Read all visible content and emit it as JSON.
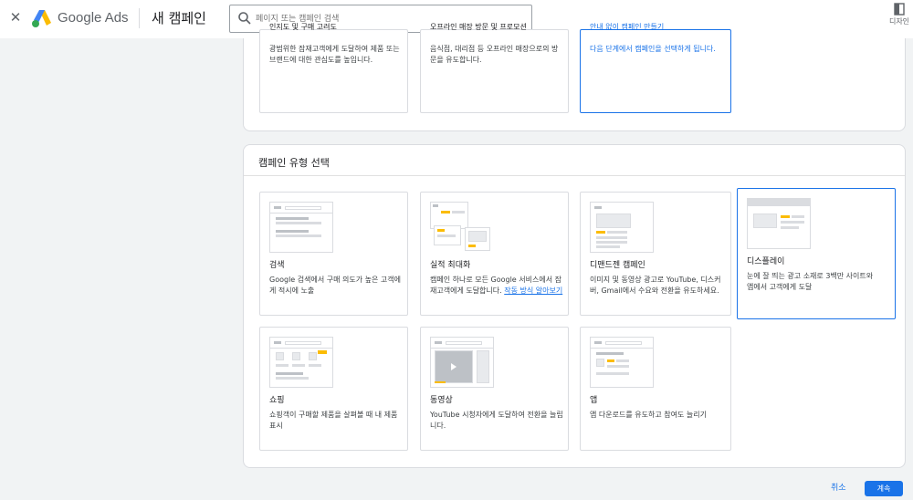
{
  "header": {
    "brand": "Google Ads",
    "page_title": "새 캠페인",
    "search_placeholder": "페이지 또는 캠페인 검색",
    "design_label": "디자인"
  },
  "top_cards": [
    {
      "title": "인지도 및 구매 고려도",
      "desc": "광범위한 잠재고객에게 도달하여 제품 또는 브랜드에 대한 관심도를 높입니다."
    },
    {
      "title": "오프라인 매장 방문 및 프로모션",
      "desc": "음식점, 대리점 등 오프라인 매장으로의 방문을 유도합니다."
    },
    {
      "title": "안내 없이 캠페인 만들기",
      "desc": "다음 단계에서 캠페인을 선택하게 됩니다."
    }
  ],
  "campaign_type": {
    "heading": "캠페인 유형 선택",
    "cards": [
      {
        "title": "검색",
        "desc": "Google 검색에서 구매 의도가 높은 고객에게 적시에 노출"
      },
      {
        "title": "실적 최대화",
        "desc": "캠페인 하나로 모든 Google 서비스에서 잠재고객에게 도달합니다.",
        "link": "작동 방식 알아보기"
      },
      {
        "title": "디맨드젠 캠페인",
        "desc": "이미지 및 동영상 광고로 YouTube, 디스커버, Gmail에서 수요와 전환을 유도하세요."
      },
      {
        "title": "디스플레이",
        "desc": "눈에 잘 띄는 광고 소재로 3백만 사이트와 앱에서 고객에게 도달"
      },
      {
        "title": "쇼핑",
        "desc": "쇼핑객이 구매할 제품을 살펴볼 때 내 제품 표시"
      },
      {
        "title": "동영상",
        "desc": "YouTube 시청자에게 도달하여 전환을 늘립니다."
      },
      {
        "title": "앱",
        "desc": "앱 다운로드를 유도하고 참여도 늘리기"
      }
    ]
  },
  "footer": {
    "cancel_label": "취소",
    "continue_label": "계속"
  },
  "colors": {
    "accent": "#1a73e8",
    "yellow": "#fbbc04"
  }
}
